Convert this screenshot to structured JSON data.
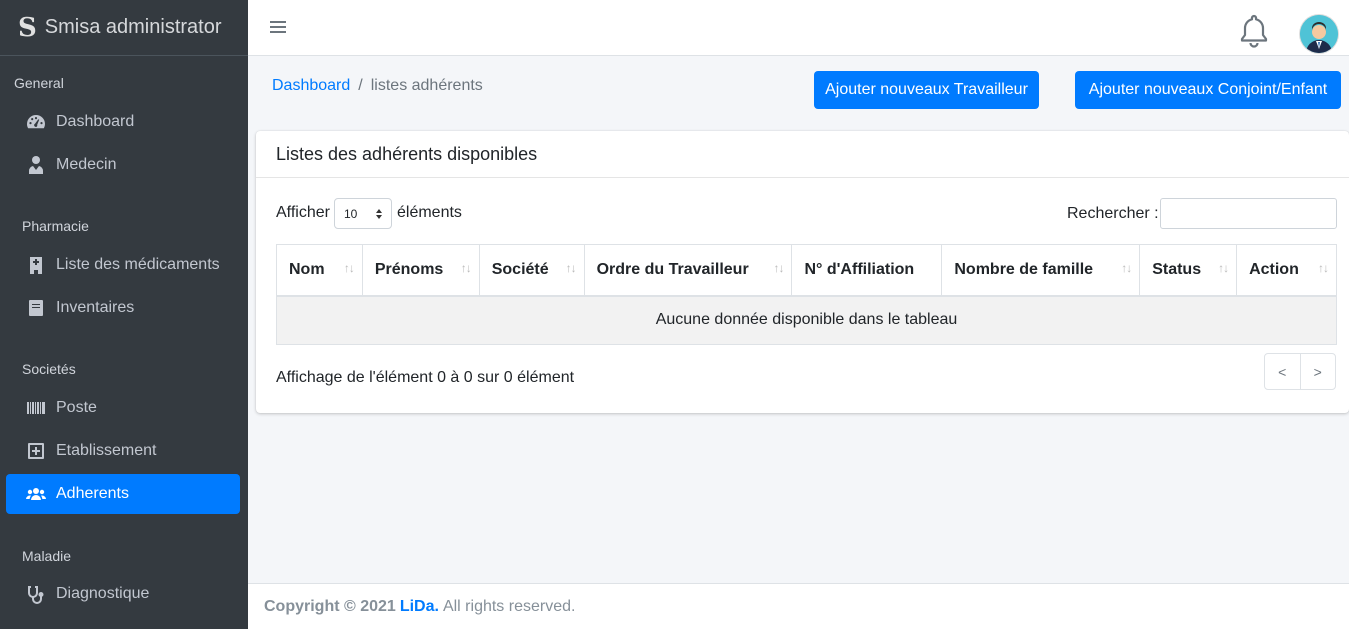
{
  "sidebar": {
    "brand_logo": "S",
    "brand_text": "Smisa administrator",
    "sections": {
      "general": "General",
      "pharmacie": "Pharmacie",
      "societes": "Societés",
      "maladie": "Maladie"
    },
    "items": {
      "dashboard": "Dashboard",
      "medecin": "Medecin",
      "medicaments": "Liste des médicaments",
      "inventaires": "Inventaires",
      "poste": "Poste",
      "etablissement": "Etablissement",
      "adherents": "Adherents",
      "diagnostique": "Diagnostique"
    },
    "active_item": "Adherents"
  },
  "breadcrumb": {
    "link": "Dashboard",
    "separator": "/",
    "current": "listes adhérents"
  },
  "buttons": {
    "add_worker": "Ajouter nouveaux Travailleur",
    "add_spouse": "Ajouter nouveaux Conjoint/Enfant"
  },
  "card": {
    "title": "Listes des adhérents disponibles",
    "show_label": "Afficher",
    "show_value": "10",
    "show_suffix": "éléments",
    "search_label": "Rechercher :",
    "columns": [
      "Nom",
      "Prénoms",
      "Société",
      "Ordre du Travailleur",
      "N° d'Affiliation",
      "Nombre de famille",
      "Status",
      "Action"
    ],
    "empty_message": "Aucune donnée disponible dans le tableau",
    "info": "Affichage de l'élément 0 à 0 sur 0 élément",
    "prev": "<",
    "next": ">"
  },
  "footer": {
    "copyright": "Copyright © 2021",
    "brand": "LiDa.",
    "rights": "All rights reserved."
  },
  "colors": {
    "primary": "#007bff",
    "sidebar_bg": "#343a40"
  },
  "icons": [
    "dashboard-icon",
    "doctor-icon",
    "hospital-icon",
    "book-icon",
    "barcode-icon",
    "plus-square-icon",
    "users-icon",
    "stethoscope-icon",
    "bell-icon",
    "avatar-icon",
    "hamburger-icon"
  ]
}
